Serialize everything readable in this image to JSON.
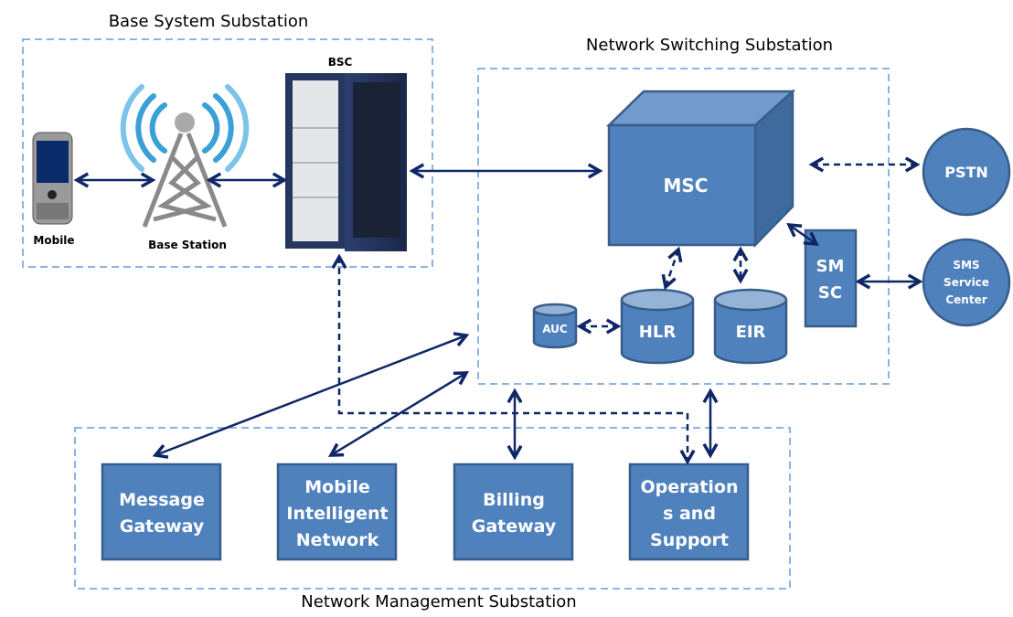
{
  "colors": {
    "node_fill": "#4f81bd",
    "node_stroke": "#385d8a",
    "arrow": "#0f2766",
    "zone_border": "#8db3e2"
  },
  "zones": {
    "bss": "Base System Substation",
    "nss": "Network Switching Substation",
    "nms": "Network Management Substation"
  },
  "devices": {
    "mobile": "Mobile",
    "base_station": "Base Station",
    "bsc": "BSC"
  },
  "nodes": {
    "msc": "MSC",
    "pstn": "PSTN",
    "smsc": [
      "SM",
      "SC"
    ],
    "sms_center": [
      "SMS",
      "Service",
      "Center"
    ],
    "hlr": "HLR",
    "eir": "EIR",
    "auc": "AUC"
  },
  "management": [
    {
      "lines": [
        "Message",
        "Gateway"
      ]
    },
    {
      "lines": [
        "Mobile",
        "Intelligent",
        "Network"
      ]
    },
    {
      "lines": [
        "Billing",
        "Gateway"
      ]
    },
    {
      "lines": [
        "Operation",
        "s and",
        "Support"
      ]
    }
  ]
}
